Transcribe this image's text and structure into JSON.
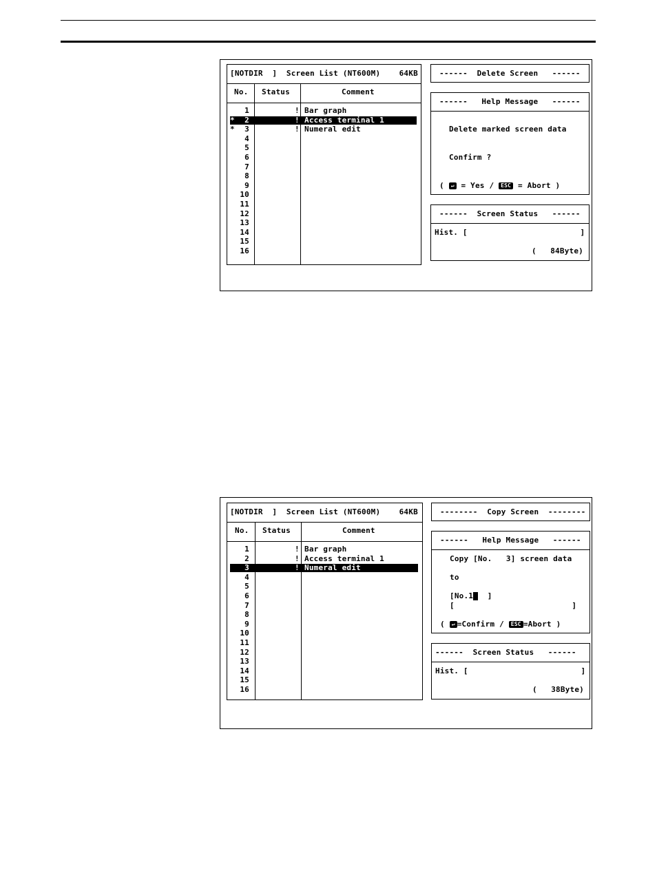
{
  "screens": [
    {
      "list_title": "[NOTDIR  ]  Screen List (NT600M)    64KB",
      "col_no": "No.",
      "col_status": "Status",
      "col_comment": "Comment",
      "rows": [
        {
          "mark": "",
          "no": "1",
          "status": "!",
          "comment": "Bar graph",
          "selected": false
        },
        {
          "mark": "*",
          "no": "2",
          "status": "!",
          "comment": "Access terminal 1",
          "selected": true
        },
        {
          "mark": "*",
          "no": "3",
          "status": "!",
          "comment": "Numeral edit",
          "selected": false
        },
        {
          "mark": "",
          "no": "4",
          "status": "",
          "comment": "",
          "selected": false
        },
        {
          "mark": "",
          "no": "5",
          "status": "",
          "comment": "",
          "selected": false
        },
        {
          "mark": "",
          "no": "6",
          "status": "",
          "comment": "",
          "selected": false
        },
        {
          "mark": "",
          "no": "7",
          "status": "",
          "comment": "",
          "selected": false
        },
        {
          "mark": "",
          "no": "8",
          "status": "",
          "comment": "",
          "selected": false
        },
        {
          "mark": "",
          "no": "9",
          "status": "",
          "comment": "",
          "selected": false
        },
        {
          "mark": "",
          "no": "10",
          "status": "",
          "comment": "",
          "selected": false
        },
        {
          "mark": "",
          "no": "11",
          "status": "",
          "comment": "",
          "selected": false
        },
        {
          "mark": "",
          "no": "12",
          "status": "",
          "comment": "",
          "selected": false
        },
        {
          "mark": "",
          "no": "13",
          "status": "",
          "comment": "",
          "selected": false
        },
        {
          "mark": "",
          "no": "14",
          "status": "",
          "comment": "",
          "selected": false
        },
        {
          "mark": "",
          "no": "15",
          "status": "",
          "comment": "",
          "selected": false
        },
        {
          "mark": "",
          "no": "16",
          "status": "",
          "comment": "",
          "selected": false
        }
      ],
      "mode_title": "------  Delete Screen   ------",
      "help_title": "------   Help Message   ------",
      "help_lines": [
        "Delete marked screen data",
        "Confirm ?"
      ],
      "help_keys": {
        "open": "( ",
        "enter_key": "↵",
        "mid": " = Yes / ",
        "esc_key": "ESC",
        "end": " = Abort )"
      },
      "status_title": "------  Screen Status   ------",
      "hist": "Hist. [                        ]",
      "size": "(   84Byte)"
    },
    {
      "list_title": "[NOTDIR  ]  Screen List (NT600M)    64KB",
      "col_no": "No.",
      "col_status": "Status",
      "col_comment": "Comment",
      "rows": [
        {
          "mark": "",
          "no": "1",
          "status": "!",
          "comment": "Bar graph",
          "selected": false
        },
        {
          "mark": "",
          "no": "2",
          "status": "!",
          "comment": "Access terminal 1",
          "selected": false
        },
        {
          "mark": "",
          "no": "3",
          "status": "!",
          "comment": "Numeral edit",
          "selected": true
        },
        {
          "mark": "",
          "no": "4",
          "status": "",
          "comment": "",
          "selected": false
        },
        {
          "mark": "",
          "no": "5",
          "status": "",
          "comment": "",
          "selected": false
        },
        {
          "mark": "",
          "no": "6",
          "status": "",
          "comment": "",
          "selected": false
        },
        {
          "mark": "",
          "no": "7",
          "status": "",
          "comment": "",
          "selected": false
        },
        {
          "mark": "",
          "no": "8",
          "status": "",
          "comment": "",
          "selected": false
        },
        {
          "mark": "",
          "no": "9",
          "status": "",
          "comment": "",
          "selected": false
        },
        {
          "mark": "",
          "no": "10",
          "status": "",
          "comment": "",
          "selected": false
        },
        {
          "mark": "",
          "no": "11",
          "status": "",
          "comment": "",
          "selected": false
        },
        {
          "mark": "",
          "no": "12",
          "status": "",
          "comment": "",
          "selected": false
        },
        {
          "mark": "",
          "no": "13",
          "status": "",
          "comment": "",
          "selected": false
        },
        {
          "mark": "",
          "no": "14",
          "status": "",
          "comment": "",
          "selected": false
        },
        {
          "mark": "",
          "no": "15",
          "status": "",
          "comment": "",
          "selected": false
        },
        {
          "mark": "",
          "no": "16",
          "status": "",
          "comment": "",
          "selected": false
        }
      ],
      "mode_title": "--------  Copy Screen  --------",
      "help_title": "------   Help Message   ------",
      "help_lines": [
        "Copy [No.   3] screen data",
        "to"
      ],
      "dest_input": {
        "prefix": "[No.1",
        "suffix": "  ]"
      },
      "dest_comment": "[                         ]",
      "help_keys": {
        "open": "( ",
        "enter_key": "↵",
        "mid": "=Confirm / ",
        "esc_key": "ESC",
        "end": "=Abort )"
      },
      "status_title": "------  Screen Status   ------",
      "hist": "Hist. [                        ]",
      "size": "(   38Byte)"
    }
  ]
}
